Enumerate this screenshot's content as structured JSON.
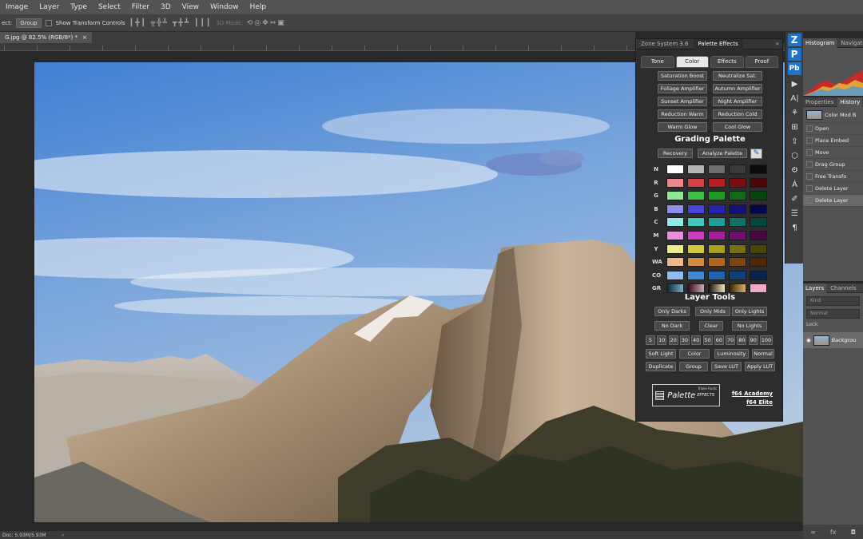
{
  "menubar": {
    "items": [
      "Image",
      "Layer",
      "Type",
      "Select",
      "Filter",
      "3D",
      "View",
      "Window",
      "Help"
    ]
  },
  "options": {
    "prefix": "ect:",
    "group_select": "Group",
    "transform_label": "Show Transform Controls",
    "mode_label": "3D Mode:"
  },
  "doc_tab": {
    "title": "G.jpg @ 82.5% (RGB/8*) *",
    "close": "×"
  },
  "status": {
    "doc": "Doc: 5.93M/5.93M",
    "arrow": "›"
  },
  "plugin": {
    "header_tabs": [
      "Zone System 3.6",
      "Palette Effects"
    ],
    "header_arrows": "»",
    "tabs": [
      "Tone",
      "Color",
      "Effects",
      "Proof"
    ],
    "active_tab": "Color",
    "effects": [
      [
        "Saturation Boost",
        "Neutralize Sat."
      ],
      [
        "Foliage Amplifier",
        "Autumn Amplifier"
      ],
      [
        "Sunset Amplifier",
        "Night Amplifier"
      ],
      [
        "Reduction Warm",
        "Reduction Cold"
      ],
      [
        "Warm Glow",
        "Cool Glow"
      ]
    ],
    "grading_title": "Grading Palette",
    "grading_buttons": [
      "Recovery",
      "Analyze Palette"
    ],
    "rows": [
      {
        "label": "N",
        "colors": [
          "#ffffff",
          "#b5b5b5",
          "#6e6e6e",
          "#3a3a3a",
          "#0c0c0c"
        ]
      },
      {
        "label": "R",
        "colors": [
          "#f0868a",
          "#d94046",
          "#b41c22",
          "#7d0c10",
          "#4e0508"
        ]
      },
      {
        "label": "G",
        "colors": [
          "#8fe890",
          "#3dc045",
          "#1c9a24",
          "#0f6c14",
          "#06440a"
        ]
      },
      {
        "label": "B",
        "colors": [
          "#8e8ef0",
          "#4646d8",
          "#2424b0",
          "#12127c",
          "#06064c"
        ]
      },
      {
        "label": "C",
        "colors": [
          "#8eeae2",
          "#3ec8c0",
          "#1e9e98",
          "#10706a",
          "#064640"
        ]
      },
      {
        "label": "M",
        "colors": [
          "#ea8ee2",
          "#cc3ec4",
          "#a21e9a",
          "#740e6e",
          "#480642"
        ]
      },
      {
        "label": "Y",
        "colors": [
          "#f0ea8e",
          "#d2c83c",
          "#aaa01c",
          "#787010",
          "#4c4606"
        ]
      },
      {
        "label": "WA",
        "colors": [
          "#eeb98a",
          "#d68a3c",
          "#b0661c",
          "#7c4410",
          "#4e2806"
        ]
      },
      {
        "label": "CO",
        "colors": [
          "#8ebef0",
          "#3e8ad8",
          "#1e62b0",
          "#10407c",
          "#06244c"
        ]
      },
      {
        "label": "GR",
        "colors": [
          "gradient1",
          "gradient2",
          "gradient3",
          "gradient4",
          "#f0a8c8"
        ]
      }
    ],
    "layer_tools_title": "Layer Tools",
    "layer_tools_row1": [
      "Only Darks",
      "Only Mids",
      "Only Lights"
    ],
    "layer_tools_row2": [
      "No Dark",
      "Clear",
      "No Lights"
    ],
    "opacity": [
      "5",
      "10",
      "20",
      "30",
      "40",
      "50",
      "60",
      "70",
      "80",
      "90",
      "100"
    ],
    "blend_row": [
      "Soft Light",
      "Color",
      "Luminosity",
      "Normal"
    ],
    "action_row": [
      "Duplicate",
      "Group",
      "Save LUT",
      "Apply LUT"
    ],
    "brand": {
      "main": "Palette",
      "sub": "Blake Rudis",
      "effects": "EFFECTS"
    },
    "links": [
      "f64 Academy",
      "f64 Elite"
    ]
  },
  "right": {
    "histogram_tabs": [
      "Histogram",
      "Navigator"
    ],
    "history_tabs": [
      "Properties",
      "History"
    ],
    "snapshot": "Color Mod B",
    "history_items": [
      "Open",
      "Place Embed",
      "Move",
      "Drag Group",
      "Free Transfo",
      "Delete Layer",
      "Delete Layer"
    ],
    "layers_tabs": [
      "Layers",
      "Channels"
    ],
    "kind": "Kind",
    "blend": "Normal",
    "lock": "Lock:",
    "background_layer": "Backgrou"
  }
}
